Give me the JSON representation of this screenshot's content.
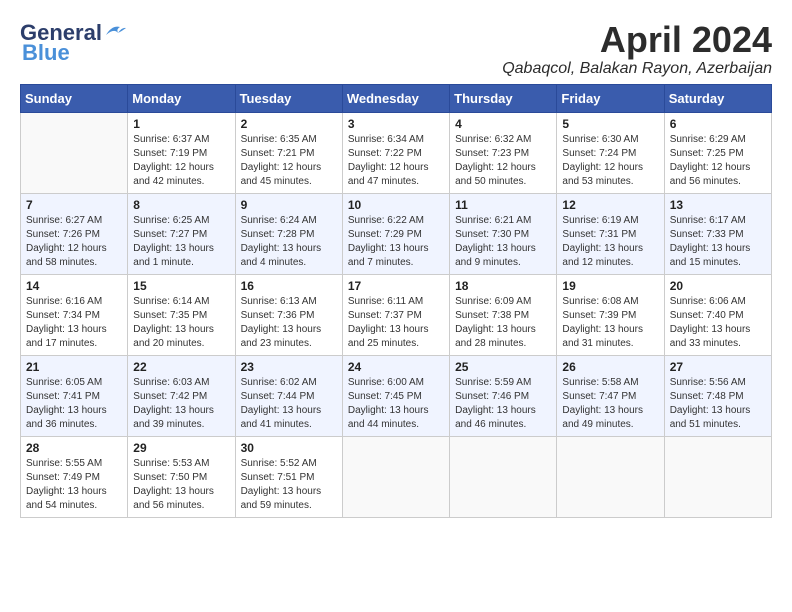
{
  "header": {
    "logo_line1": "General",
    "logo_line2": "Blue",
    "month": "April 2024",
    "location": "Qabaqcol, Balakan Rayon, Azerbaijan"
  },
  "days_of_week": [
    "Sunday",
    "Monday",
    "Tuesday",
    "Wednesday",
    "Thursday",
    "Friday",
    "Saturday"
  ],
  "weeks": [
    [
      {
        "day": "",
        "sunrise": "",
        "sunset": "",
        "daylight": ""
      },
      {
        "day": "1",
        "sunrise": "Sunrise: 6:37 AM",
        "sunset": "Sunset: 7:19 PM",
        "daylight": "Daylight: 12 hours and 42 minutes."
      },
      {
        "day": "2",
        "sunrise": "Sunrise: 6:35 AM",
        "sunset": "Sunset: 7:21 PM",
        "daylight": "Daylight: 12 hours and 45 minutes."
      },
      {
        "day": "3",
        "sunrise": "Sunrise: 6:34 AM",
        "sunset": "Sunset: 7:22 PM",
        "daylight": "Daylight: 12 hours and 47 minutes."
      },
      {
        "day": "4",
        "sunrise": "Sunrise: 6:32 AM",
        "sunset": "Sunset: 7:23 PM",
        "daylight": "Daylight: 12 hours and 50 minutes."
      },
      {
        "day": "5",
        "sunrise": "Sunrise: 6:30 AM",
        "sunset": "Sunset: 7:24 PM",
        "daylight": "Daylight: 12 hours and 53 minutes."
      },
      {
        "day": "6",
        "sunrise": "Sunrise: 6:29 AM",
        "sunset": "Sunset: 7:25 PM",
        "daylight": "Daylight: 12 hours and 56 minutes."
      }
    ],
    [
      {
        "day": "7",
        "sunrise": "Sunrise: 6:27 AM",
        "sunset": "Sunset: 7:26 PM",
        "daylight": "Daylight: 12 hours and 58 minutes."
      },
      {
        "day": "8",
        "sunrise": "Sunrise: 6:25 AM",
        "sunset": "Sunset: 7:27 PM",
        "daylight": "Daylight: 13 hours and 1 minute."
      },
      {
        "day": "9",
        "sunrise": "Sunrise: 6:24 AM",
        "sunset": "Sunset: 7:28 PM",
        "daylight": "Daylight: 13 hours and 4 minutes."
      },
      {
        "day": "10",
        "sunrise": "Sunrise: 6:22 AM",
        "sunset": "Sunset: 7:29 PM",
        "daylight": "Daylight: 13 hours and 7 minutes."
      },
      {
        "day": "11",
        "sunrise": "Sunrise: 6:21 AM",
        "sunset": "Sunset: 7:30 PM",
        "daylight": "Daylight: 13 hours and 9 minutes."
      },
      {
        "day": "12",
        "sunrise": "Sunrise: 6:19 AM",
        "sunset": "Sunset: 7:31 PM",
        "daylight": "Daylight: 13 hours and 12 minutes."
      },
      {
        "day": "13",
        "sunrise": "Sunrise: 6:17 AM",
        "sunset": "Sunset: 7:33 PM",
        "daylight": "Daylight: 13 hours and 15 minutes."
      }
    ],
    [
      {
        "day": "14",
        "sunrise": "Sunrise: 6:16 AM",
        "sunset": "Sunset: 7:34 PM",
        "daylight": "Daylight: 13 hours and 17 minutes."
      },
      {
        "day": "15",
        "sunrise": "Sunrise: 6:14 AM",
        "sunset": "Sunset: 7:35 PM",
        "daylight": "Daylight: 13 hours and 20 minutes."
      },
      {
        "day": "16",
        "sunrise": "Sunrise: 6:13 AM",
        "sunset": "Sunset: 7:36 PM",
        "daylight": "Daylight: 13 hours and 23 minutes."
      },
      {
        "day": "17",
        "sunrise": "Sunrise: 6:11 AM",
        "sunset": "Sunset: 7:37 PM",
        "daylight": "Daylight: 13 hours and 25 minutes."
      },
      {
        "day": "18",
        "sunrise": "Sunrise: 6:09 AM",
        "sunset": "Sunset: 7:38 PM",
        "daylight": "Daylight: 13 hours and 28 minutes."
      },
      {
        "day": "19",
        "sunrise": "Sunrise: 6:08 AM",
        "sunset": "Sunset: 7:39 PM",
        "daylight": "Daylight: 13 hours and 31 minutes."
      },
      {
        "day": "20",
        "sunrise": "Sunrise: 6:06 AM",
        "sunset": "Sunset: 7:40 PM",
        "daylight": "Daylight: 13 hours and 33 minutes."
      }
    ],
    [
      {
        "day": "21",
        "sunrise": "Sunrise: 6:05 AM",
        "sunset": "Sunset: 7:41 PM",
        "daylight": "Daylight: 13 hours and 36 minutes."
      },
      {
        "day": "22",
        "sunrise": "Sunrise: 6:03 AM",
        "sunset": "Sunset: 7:42 PM",
        "daylight": "Daylight: 13 hours and 39 minutes."
      },
      {
        "day": "23",
        "sunrise": "Sunrise: 6:02 AM",
        "sunset": "Sunset: 7:44 PM",
        "daylight": "Daylight: 13 hours and 41 minutes."
      },
      {
        "day": "24",
        "sunrise": "Sunrise: 6:00 AM",
        "sunset": "Sunset: 7:45 PM",
        "daylight": "Daylight: 13 hours and 44 minutes."
      },
      {
        "day": "25",
        "sunrise": "Sunrise: 5:59 AM",
        "sunset": "Sunset: 7:46 PM",
        "daylight": "Daylight: 13 hours and 46 minutes."
      },
      {
        "day": "26",
        "sunrise": "Sunrise: 5:58 AM",
        "sunset": "Sunset: 7:47 PM",
        "daylight": "Daylight: 13 hours and 49 minutes."
      },
      {
        "day": "27",
        "sunrise": "Sunrise: 5:56 AM",
        "sunset": "Sunset: 7:48 PM",
        "daylight": "Daylight: 13 hours and 51 minutes."
      }
    ],
    [
      {
        "day": "28",
        "sunrise": "Sunrise: 5:55 AM",
        "sunset": "Sunset: 7:49 PM",
        "daylight": "Daylight: 13 hours and 54 minutes."
      },
      {
        "day": "29",
        "sunrise": "Sunrise: 5:53 AM",
        "sunset": "Sunset: 7:50 PM",
        "daylight": "Daylight: 13 hours and 56 minutes."
      },
      {
        "day": "30",
        "sunrise": "Sunrise: 5:52 AM",
        "sunset": "Sunset: 7:51 PM",
        "daylight": "Daylight: 13 hours and 59 minutes."
      },
      {
        "day": "",
        "sunrise": "",
        "sunset": "",
        "daylight": ""
      },
      {
        "day": "",
        "sunrise": "",
        "sunset": "",
        "daylight": ""
      },
      {
        "day": "",
        "sunrise": "",
        "sunset": "",
        "daylight": ""
      },
      {
        "day": "",
        "sunrise": "",
        "sunset": "",
        "daylight": ""
      }
    ]
  ]
}
